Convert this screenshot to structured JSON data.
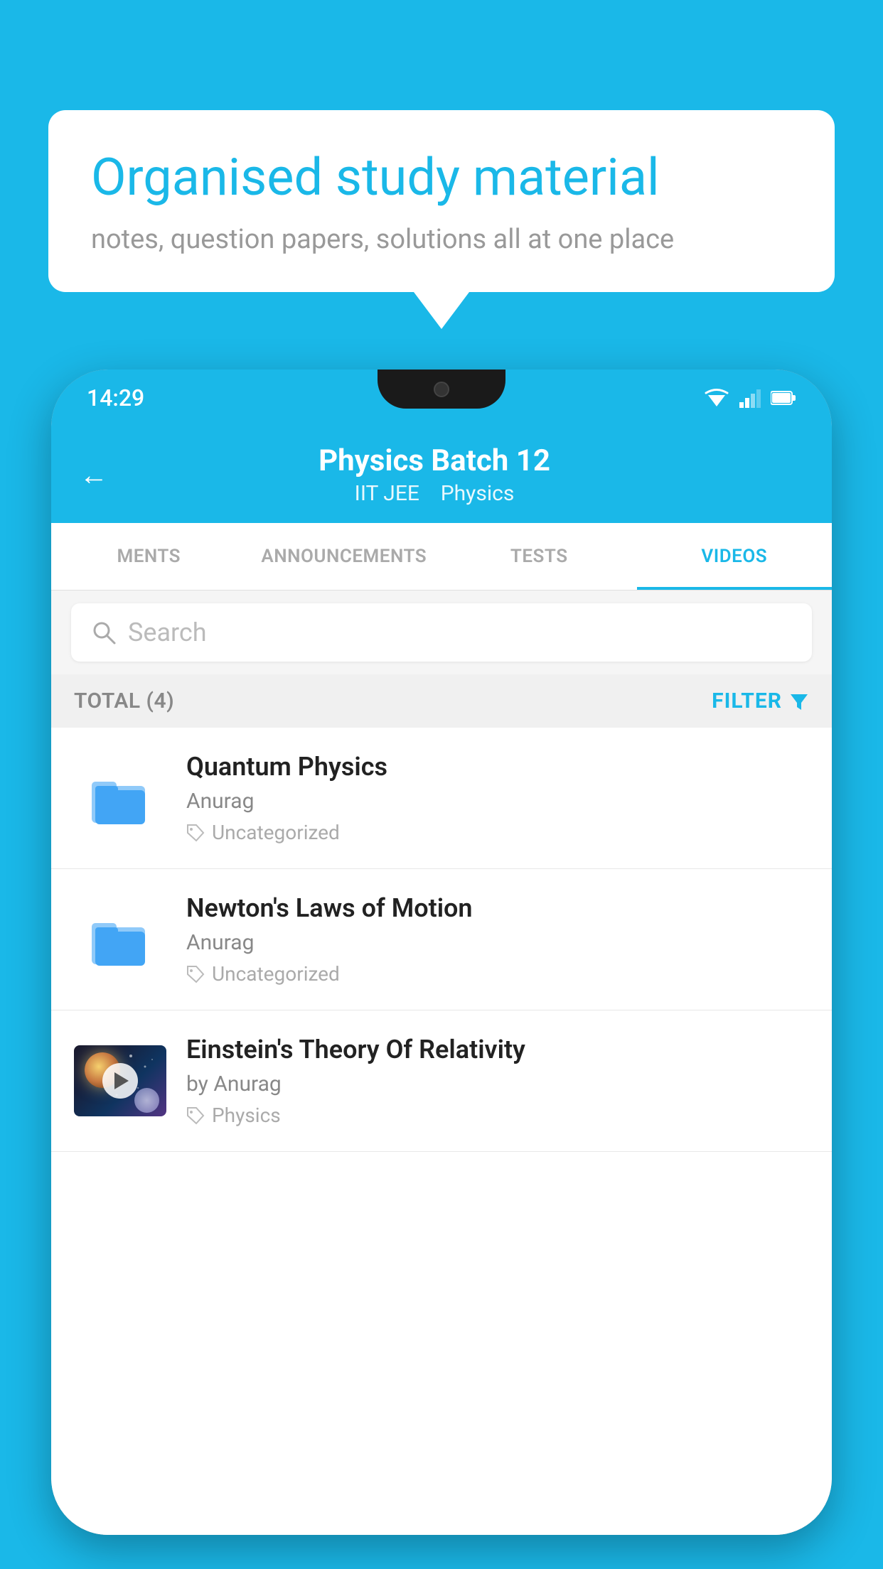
{
  "background_color": "#1ab8e8",
  "bubble": {
    "title": "Organised study material",
    "subtitle": "notes, question papers, solutions all at one place"
  },
  "phone": {
    "status_bar": {
      "time": "14:29",
      "wifi": "▾",
      "signal": "▲",
      "battery": "▮"
    },
    "header": {
      "back_label": "←",
      "title": "Physics Batch 12",
      "subtitle_parts": [
        "IIT JEE",
        "Physics"
      ]
    },
    "tabs": [
      {
        "label": "MENTS",
        "active": false
      },
      {
        "label": "ANNOUNCEMENTS",
        "active": false
      },
      {
        "label": "TESTS",
        "active": false
      },
      {
        "label": "VIDEOS",
        "active": true
      }
    ],
    "search": {
      "placeholder": "Search"
    },
    "filter_bar": {
      "total_label": "TOTAL (4)",
      "filter_label": "FILTER"
    },
    "videos": [
      {
        "id": "1",
        "title": "Quantum Physics",
        "author": "Anurag",
        "tag": "Uncategorized",
        "type": "folder"
      },
      {
        "id": "2",
        "title": "Newton's Laws of Motion",
        "author": "Anurag",
        "tag": "Uncategorized",
        "type": "folder"
      },
      {
        "id": "3",
        "title": "Einstein's Theory Of Relativity",
        "author": "by Anurag",
        "tag": "Physics",
        "type": "video"
      }
    ]
  }
}
